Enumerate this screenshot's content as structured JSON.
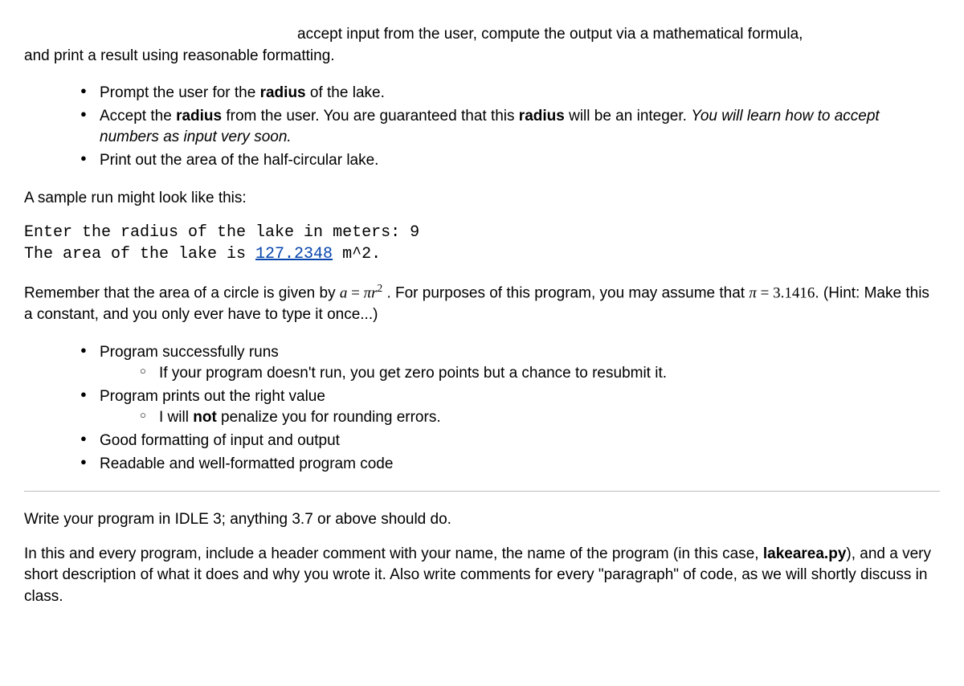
{
  "intro": {
    "line1": "accept input from the user, compute the output via a mathematical formula,",
    "line2": "and print a result using reasonable formatting."
  },
  "steps": {
    "s1_a": "Prompt the user for the ",
    "s1_b": "radius",
    "s1_c": " of the lake.",
    "s2_a": "Accept the ",
    "s2_b": "radius",
    "s2_c": " from the user.  You are guaranteed that this ",
    "s2_d": "radius",
    "s2_e": " will be an integer.  ",
    "s2_f": "You will learn how to accept numbers as input very soon.",
    "s3": "Print out the area of the half-circular lake."
  },
  "sample_intro": "A sample run might look like this:",
  "code": {
    "line1": "Enter the radius of the lake in meters: 9",
    "line2_a": "The area of the lake is ",
    "line2_link": "127.2348",
    "line2_b": " m^2."
  },
  "remember": {
    "r1": "Remember that the area of a circle is given by ",
    "r_eq_a": "a",
    "r_eq_eq": " = ",
    "r_eq_pi": "π",
    "r_eq_r": "r",
    "r_eq_sup": "2",
    "r2": " .  For purposes of this program, you may assume that ",
    "r3_pi": "π",
    "r3_eq": " = ",
    "r3_val": "3.1416",
    "r4": ".  (Hint: Make this a constant, and you only ever have to type it once...)"
  },
  "criteria": {
    "c1": "Program successfully runs",
    "c1_sub": "If your program doesn't run, you get zero points but a chance to resubmit it.",
    "c2": "Program prints out the right value",
    "c2_sub_a": "I will ",
    "c2_sub_b": "not",
    "c2_sub_c": " penalize you for rounding errors.",
    "c3": "Good formatting of input and output",
    "c4": "Readable and well-formatted program code"
  },
  "closing": {
    "p1": "Write your program in IDLE 3; anything 3.7 or above should do.",
    "p2_a": "In this and every program, include a header comment with your name, the name of the program (in this case, ",
    "p2_b": "lakearea.py",
    "p2_c": "), and a very short description of what it does and why you wrote it.  Also write comments for every \"paragraph\" of code, as we will shortly discuss in class."
  }
}
